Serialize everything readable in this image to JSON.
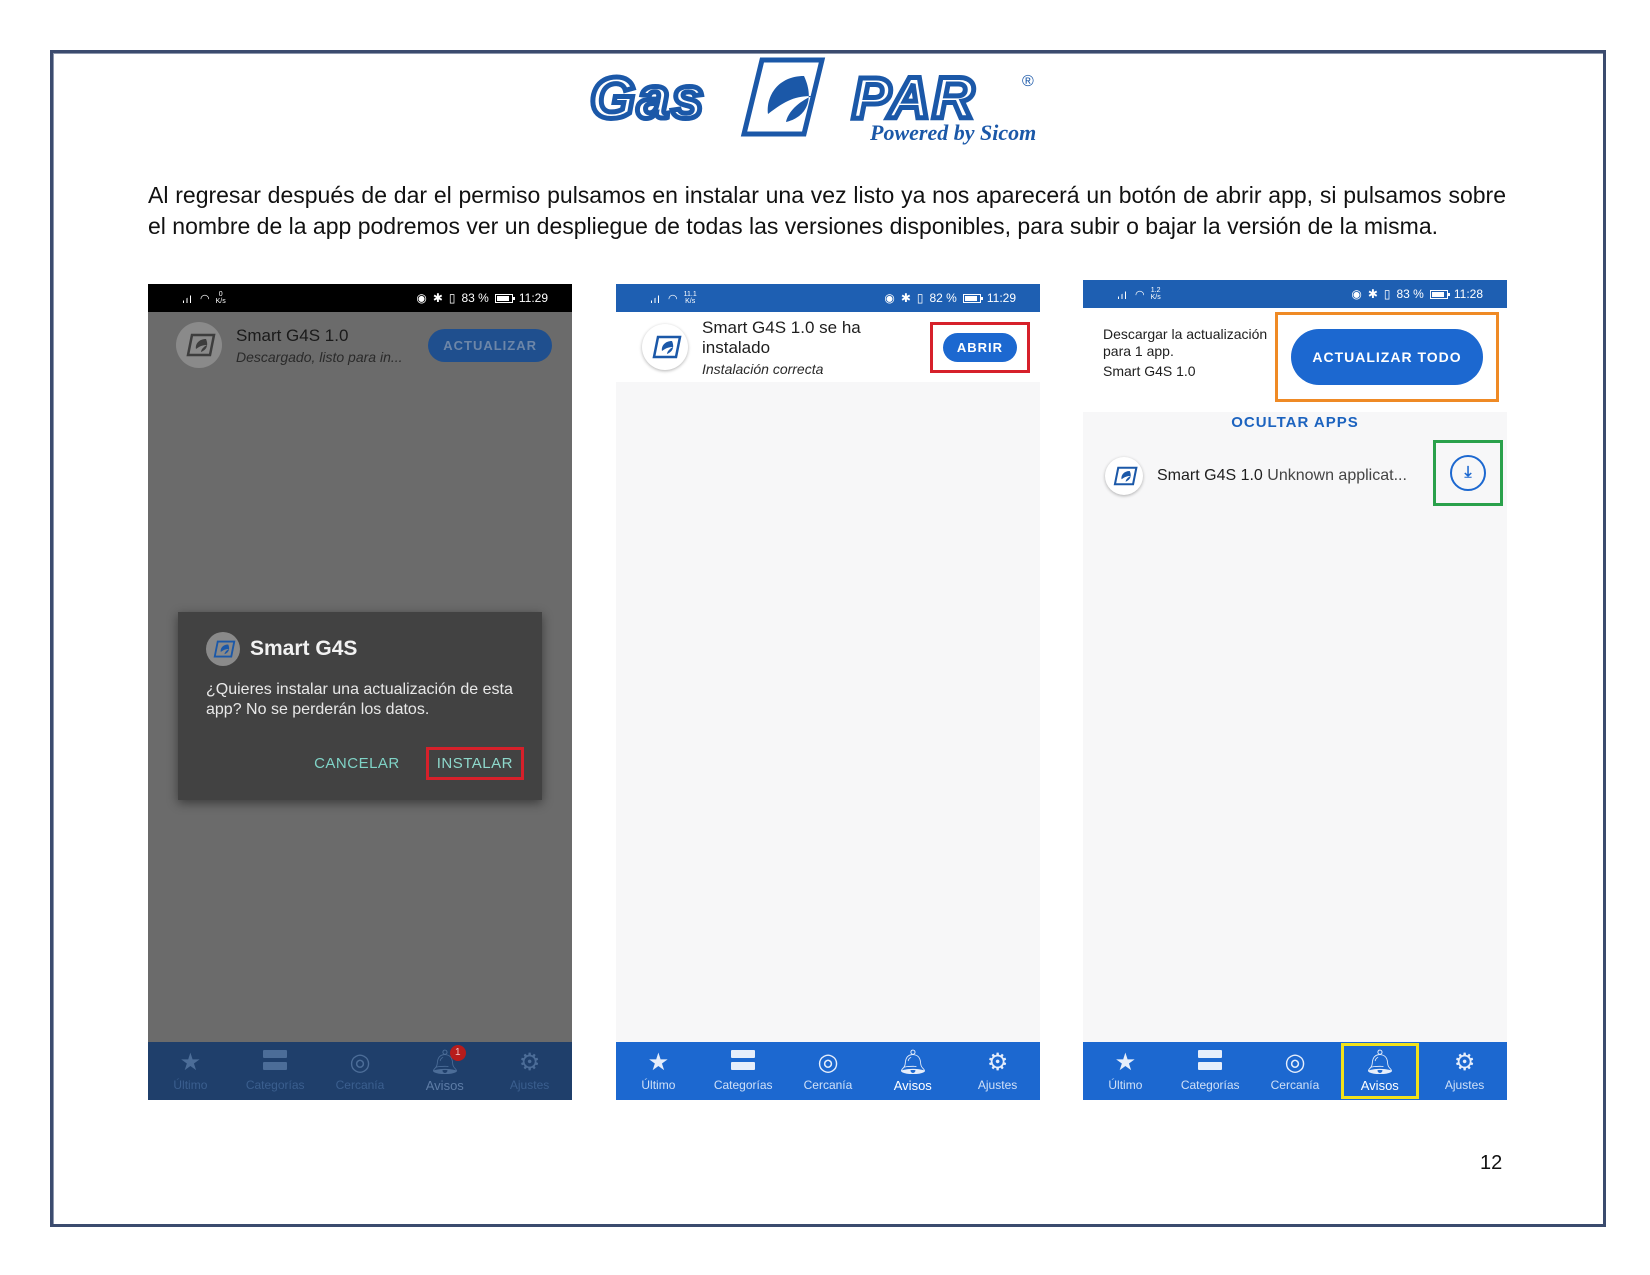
{
  "logo": {
    "brand_left": "Gas",
    "brand_right": "PAR",
    "registered": "®",
    "tagline": "Powered by Sicom"
  },
  "intro": "Al regresar después de dar el permiso pulsamos en instalar una vez listo ya nos aparecerá un botón de abrir app, si pulsamos sobre el nombre de la app podremos ver un despliegue de todas las versiones disponibles, para subir o bajar la versión de la misma.",
  "page_number": "12",
  "colors": {
    "accent": "#1c68d0",
    "highlight_red": "#d6202a",
    "highlight_orange": "#ef8a25",
    "highlight_green": "#2aa14b",
    "highlight_yellow": "#f1e21b"
  },
  "phone1": {
    "status": {
      "speed_top": "0",
      "speed_unit": "K/s",
      "battery": "83 %",
      "time": "11:29"
    },
    "row": {
      "title": "Smart G4S 1.0",
      "subtitle": "Descargado, listo para in...",
      "button": "ACTUALIZAR"
    },
    "dialog": {
      "title": "Smart G4S",
      "body": "¿Quieres instalar una actualización de esta app? No se perderán los datos.",
      "cancel": "CANCELAR",
      "install": "INSTALAR"
    },
    "nav": [
      {
        "label": "Último",
        "icon": "star-icon"
      },
      {
        "label": "Categorías",
        "icon": "categories-icon"
      },
      {
        "label": "Cercanía",
        "icon": "nearby-icon"
      },
      {
        "label": "Avisos",
        "icon": "bell-icon",
        "badge": "1"
      },
      {
        "label": "Ajustes",
        "icon": "gear-icon"
      }
    ]
  },
  "phone2": {
    "status": {
      "speed_top": "11.1",
      "speed_unit": "K/s",
      "battery": "82 %",
      "time": "11:29"
    },
    "row": {
      "title": "Smart G4S 1.0 se ha instalado",
      "subtitle": "Instalación correcta",
      "button": "ABRIR"
    },
    "nav": [
      {
        "label": "Último",
        "icon": "star-icon"
      },
      {
        "label": "Categorías",
        "icon": "categories-icon"
      },
      {
        "label": "Cercanía",
        "icon": "nearby-icon"
      },
      {
        "label": "Avisos",
        "icon": "bell-icon"
      },
      {
        "label": "Ajustes",
        "icon": "gear-icon"
      }
    ]
  },
  "phone3": {
    "status": {
      "speed_top": "1.2",
      "speed_unit": "K/s",
      "battery": "83 %",
      "time": "11:28"
    },
    "update_text": "Descargar la actualización para 1 app.",
    "update_app": "Smart G4S 1.0",
    "update_button": "ACTUALIZAR TODO",
    "hide_apps": "OCULTAR APPS",
    "row": {
      "title": "Smart G4S 1.0",
      "subtitle": "Unknown applicat..."
    },
    "nav": [
      {
        "label": "Último",
        "icon": "star-icon"
      },
      {
        "label": "Categorías",
        "icon": "categories-icon"
      },
      {
        "label": "Cercanía",
        "icon": "nearby-icon"
      },
      {
        "label": "Avisos",
        "icon": "bell-icon"
      },
      {
        "label": "Ajustes",
        "icon": "gear-icon"
      }
    ]
  }
}
